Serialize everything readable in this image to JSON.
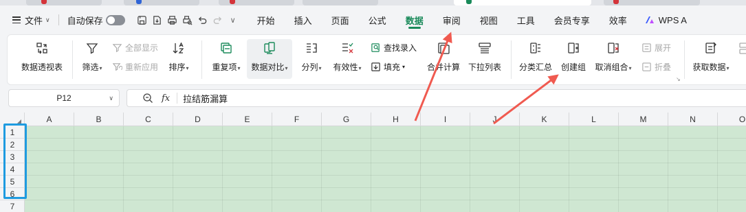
{
  "menubar": {
    "file": "文件",
    "autosave": "自动保存",
    "tabs": [
      {
        "label": "开始"
      },
      {
        "label": "插入"
      },
      {
        "label": "页面"
      },
      {
        "label": "公式"
      },
      {
        "label": "数据",
        "active": true
      },
      {
        "label": "审阅"
      },
      {
        "label": "视图"
      },
      {
        "label": "工具"
      },
      {
        "label": "会员专享"
      },
      {
        "label": "效率"
      }
    ],
    "wps_ai": "WPS A"
  },
  "ribbon": {
    "pivot": "数据透视表",
    "filter": "筛选",
    "show_all": "全部显示",
    "reapply": "重新应用",
    "sort": "排序",
    "duplicates": "重复项",
    "compare": "数据对比",
    "split": "分列",
    "validity": "有效性",
    "lookup_entry": "查找录入",
    "fill": "填充",
    "consolidate": "合并计算",
    "dropdown_list": "下拉列表",
    "subtotal": "分类汇总",
    "create_group": "创建组",
    "ungroup": "取消组合",
    "expand": "展开",
    "collapse": "折叠",
    "get_data": "获取数据"
  },
  "formula_bar": {
    "cell_ref": "P12",
    "fx": "fx",
    "content": "拉结筋漏算"
  },
  "sheet": {
    "columns": [
      "A",
      "B",
      "C",
      "D",
      "E",
      "F",
      "G",
      "H",
      "I",
      "J",
      "K",
      "L",
      "M",
      "N",
      "O"
    ],
    "rows": [
      "1",
      "2",
      "3",
      "4",
      "5",
      "6",
      "7"
    ]
  },
  "colors": {
    "accent": "#1a8a5a",
    "sheet_fill": "#cfe7d2",
    "annotation_arrow": "#f05a50",
    "row_highlight": "#1e9be0"
  }
}
